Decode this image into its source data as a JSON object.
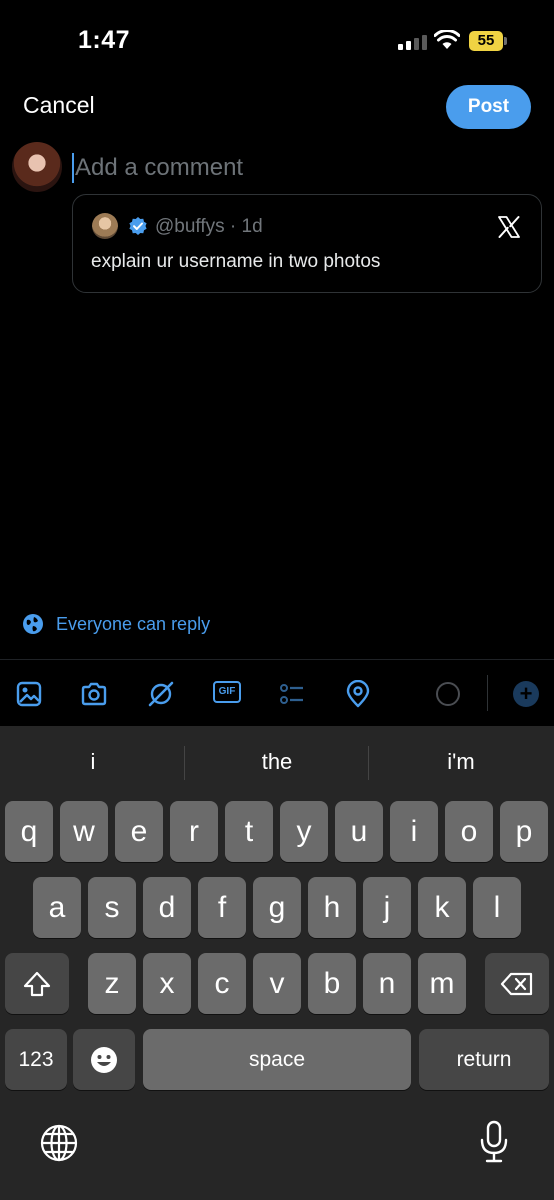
{
  "status_bar": {
    "time": "1:47",
    "battery": "55",
    "battery_color": "#f0d343"
  },
  "compose": {
    "cancel_label": "Cancel",
    "post_label": "Post",
    "placeholder": "Add a comment",
    "accent_color": "#4a9ded"
  },
  "quoted_post": {
    "handle_time": "@buffys · 1d",
    "text": "explain ur username in two photos"
  },
  "reply_setting": {
    "label": "Everyone can reply",
    "icon": "globe-icon"
  },
  "toolbar": {
    "icons": [
      "image-icon",
      "camera-icon",
      "grok-icon",
      "gif-icon",
      "poll-icon",
      "location-icon",
      "character-count-ring",
      "add-post-icon"
    ],
    "gif_label": "GIF"
  },
  "keyboard": {
    "suggestions": [
      "i",
      "the",
      "i'm"
    ],
    "row1": [
      "q",
      "w",
      "e",
      "r",
      "t",
      "y",
      "u",
      "i",
      "o",
      "p"
    ],
    "row2": [
      "a",
      "s",
      "d",
      "f",
      "g",
      "h",
      "j",
      "k",
      "l"
    ],
    "row3": [
      "z",
      "x",
      "c",
      "v",
      "b",
      "n",
      "m"
    ],
    "numbers_label": "123",
    "space_label": "space",
    "return_label": "return"
  }
}
